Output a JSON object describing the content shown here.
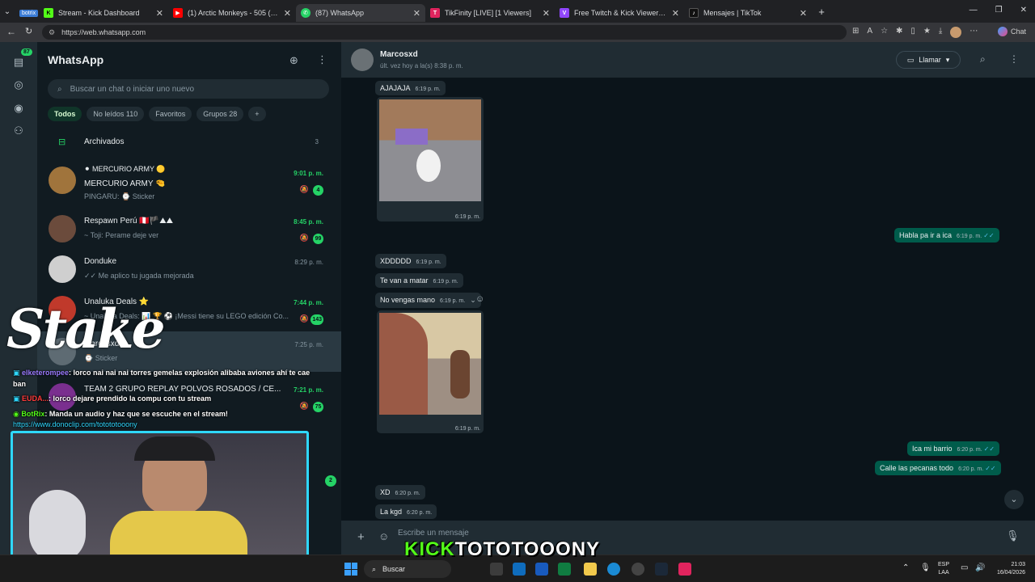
{
  "browser": {
    "tabs": [
      {
        "label": "botrix",
        "icon": "botrix-icon",
        "color": "#3a7bd5"
      },
      {
        "label": "Stream - Kick Dashboard",
        "icon": "kick-icon",
        "color": "#53fc18"
      },
      {
        "label": "(1) Arctic Monkeys - 505 ( My ...",
        "icon": "youtube-icon",
        "color": "#ff0000"
      },
      {
        "label": "(87) WhatsApp",
        "icon": "whatsapp-icon",
        "color": "#25d366"
      },
      {
        "label": "TikFinity [LIVE] [1 Viewers]",
        "icon": "tikfinity-icon",
        "color": "#e0245e"
      },
      {
        "label": "Free Twitch & Kick Viewers - Try 1...",
        "icon": "twitch-icon",
        "color": "#9146ff"
      },
      {
        "label": "Mensajes | TikTok",
        "icon": "tiktok-icon",
        "color": "#111111"
      }
    ],
    "url": "https://web.whatsapp.com",
    "chat_button": "Chat"
  },
  "rail": {
    "chats_badge": "87"
  },
  "sidebar": {
    "title": "WhatsApp",
    "search_placeholder": "Buscar un chat o iniciar uno nuevo",
    "filters": [
      "Todos",
      "No leídos 110",
      "Favoritos",
      "Grupos 28"
    ],
    "archived_label": "Archivados",
    "archived_count": "3",
    "chats": [
      {
        "name": "⚫ MERCURIO ARMY 🟡",
        "name2": "MERCURIO ARMY 🤏",
        "msg": "PINGARU: ⌚ Sticker",
        "time": "9:01 p. m.",
        "badge": "4",
        "unread": true,
        "muted": true,
        "avatar": "#a0743c"
      },
      {
        "name": "Respawn Perú 🇵🇪🏴⛰⛰",
        "msg": "~ Toji: Perame deje ver",
        "time": "8:45 p. m.",
        "badge": "99",
        "unread": true,
        "muted": true,
        "avatar": "#6b4b3c"
      },
      {
        "name": "Donduke",
        "msg": "✓✓ Me aplico tu jugada mejorada",
        "time": "8:29 p. m.",
        "badge": "",
        "unread": false,
        "muted": false,
        "avatar": "#cfcfcf"
      },
      {
        "name": "Unaluka Deals ⭐",
        "msg": "~ Unaluka Deals: 📊 🏆 ⚽ ¡Messi tiene su LEGO edición Co...",
        "time": "7:44 p. m.",
        "badge": "143",
        "unread": true,
        "muted": true,
        "avatar": "#c0392b"
      },
      {
        "name": "Marcosxd",
        "msg": "⌚ Sticker",
        "time": "7:25 p. m.",
        "badge": "",
        "unread": false,
        "muted": false,
        "avatar": "#5e6b73"
      },
      {
        "name": "TEAM 2 GRUPO REPLAY POLVOS ROSADOS / CE...",
        "msg": "",
        "time": "7:21 p. m.",
        "badge": "75",
        "unread": true,
        "muted": true,
        "avatar": "#7a2f8f"
      }
    ]
  },
  "conversation": {
    "contact": "Marcosxd",
    "last_seen": "últ. vez hoy a la(s) 8:38 p. m.",
    "call_label": "Llamar",
    "composer_placeholder": "Escribe un mensaje",
    "messages": {
      "m1": {
        "text": "AJAJAJA",
        "time": "6:19 p. m."
      },
      "img1_time": "6:19 p. m.",
      "out1": {
        "text": "Habla pa ir a ica",
        "time": "6:19 p. m."
      },
      "m2": {
        "text": "XDDDDD",
        "time": "6:19 p. m."
      },
      "m3": {
        "text": "Te van a matar",
        "time": "6:19 p. m."
      },
      "m4": {
        "text": "No vengas mano",
        "time": "6:19 p. m."
      },
      "img2_time": "6:19 p. m.",
      "out2": {
        "text": "Ica mi barrio",
        "time": "6:20 p. m."
      },
      "out3": {
        "text": "Calle las pecanas todo",
        "time": "6:20 p. m."
      },
      "m5": {
        "text": "XD",
        "time": "6:20 p. m."
      },
      "m6": {
        "text": "La kgd",
        "time": "6:20 p. m."
      }
    }
  },
  "overlay": {
    "stake": "Stake",
    "chat_lines": [
      {
        "user": "elketerompee",
        "text": ": lorco nai nai nai torres gemelas explosión alibaba aviones ahí te cae ban"
      },
      {
        "user": "EUDA...",
        "text": ": lorco dejare prendido la compu con tu stream"
      },
      {
        "user": "BotRix",
        "text": ": Manda un audio y haz que se escuche en el stream!"
      },
      {
        "user": "",
        "text": "https://www.donoclip.com/totototooony"
      }
    ],
    "kick_word": "KICK",
    "channel": "TOTOTOOONY"
  },
  "taskbar": {
    "search": "Buscar",
    "lang1": "ESP",
    "lang2": "LAA",
    "time": "21:03",
    "date": "16/04/2026"
  }
}
